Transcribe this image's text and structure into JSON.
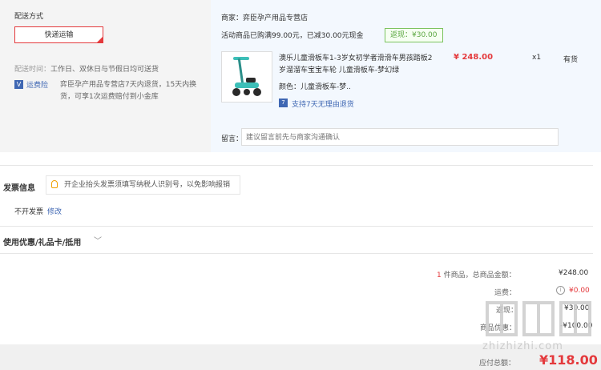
{
  "shipping": {
    "title": "配送方式",
    "option_label": "快递运输",
    "time_label": "配送时间：",
    "time_value": "工作日、双休日与节假日均可送货",
    "insurance_icon": "V",
    "insurance_link": "运费险",
    "insurance_desc": "弈臣孕产用品专营店7天内退货，15天内换货，可享1次运费赔付到小金库"
  },
  "order": {
    "seller": "商家：弈臣孕产用品专营店",
    "promo": "活动商品已购满99.00元，已减30.00元现金",
    "rebate_badge": "返现：¥30.00",
    "product": {
      "name": "澳乐儿童滑板车1-3岁女初学者滑滑车男孩踏板2岁溜溜车宝宝车轮 儿童滑板车-梦幻绿",
      "price": "¥ 248.00",
      "qty": "x1",
      "stock": "有货",
      "color": "颜色：儿童滑板车-梦..",
      "return_icon": "7",
      "return_text": "支持7天无理由退货",
      "image_icon": "scooter-image"
    },
    "message_label": "留言：",
    "message_placeholder": "建议留言前先与商家沟通确认"
  },
  "invoice": {
    "title": "发票信息",
    "tip": "开企业抬头发票须填写纳税人识别号，以免影响报销",
    "value": "不开发票",
    "edit": "修改"
  },
  "coupon": {
    "title": "使用优惠/礼品卡/抵用",
    "chevron": "﹀"
  },
  "summary": {
    "count_n": "1",
    "count_text": " 件商品，总商品金额：",
    "total": "¥248.00",
    "shipping_label": "运费：",
    "shipping_info_icon": "i",
    "shipping_value": "¥0.00",
    "rebate_label": "返现：",
    "rebate_value": "¥30.00",
    "discount_label": "商品优惠：",
    "discount_value": "-¥100.00",
    "pay_label": "应付总额：",
    "pay_value": "¥118.00"
  },
  "watermark": {
    "text": "zhizhizhi.com",
    "color": "#cccccc"
  },
  "colors": {
    "accent_red": "#e4393c",
    "link_blue": "#3f67b3",
    "rebate_green": "#5aa63f"
  }
}
